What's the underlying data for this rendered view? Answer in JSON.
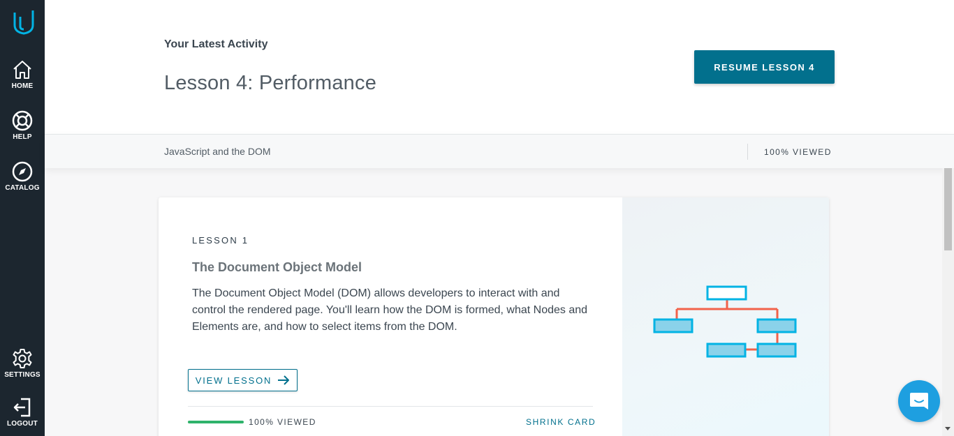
{
  "sidebar": {
    "items": [
      {
        "label": "HOME",
        "icon": "home-icon"
      },
      {
        "label": "HELP",
        "icon": "lifebuoy-icon"
      },
      {
        "label": "CATALOG",
        "icon": "compass-icon"
      },
      {
        "label": "SETTINGS",
        "icon": "gear-icon"
      },
      {
        "label": "LOGOUT",
        "icon": "logout-icon"
      }
    ]
  },
  "header": {
    "latest_label": "Your Latest Activity",
    "lesson_title": "Lesson 4: Performance",
    "resume_button": "RESUME LESSON 4"
  },
  "sub_bar": {
    "course_name": "JavaScript and the DOM",
    "viewed": "100% VIEWED"
  },
  "card": {
    "lesson_number": "LESSON 1",
    "title": "The Document Object Model",
    "description": "The Document Object Model (DOM) allows developers to interact with and control the rendered page. You'll learn how the DOM is formed, what Nodes and Elements are, and how to select items from the DOM.",
    "view_button": "VIEW LESSON",
    "progress_percent": 100,
    "viewed": "100% VIEWED",
    "shrink_button": "SHRINK CARD",
    "illustration": "dom-tree-diagram"
  },
  "colors": {
    "sidebar_bg": "#1c262f",
    "accent": "#02708d",
    "brand_blue": "#02b3e4",
    "progress_green": "#2fb36b",
    "diagram_line": "#f2624a",
    "chat_bubble": "#1e9fe0"
  },
  "chat": {
    "icon": "chat-icon"
  }
}
